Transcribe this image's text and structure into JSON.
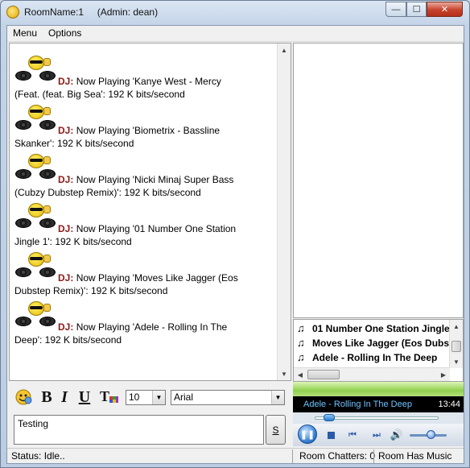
{
  "window": {
    "title": "RoomName:1     (Admin: dean)",
    "minimize_glyph": "—",
    "maximize_glyph": "☐",
    "close_glyph": "✕"
  },
  "menu": [
    "Menu",
    "Options"
  ],
  "chat": {
    "speaker": "DJ:",
    "messages": [
      {
        "line1": "Now Playing 'Kanye West - Mercy",
        "line2": "(Feat. (feat. Big Sea': 192 K bits/second"
      },
      {
        "line1": "Now Playing 'Biometrix - Bassline",
        "line2": "Skanker': 192 K bits/second"
      },
      {
        "line1": "Now Playing 'Nicki Minaj Super Bass",
        "line2": "(Cubzy Dubstep Remix)': 192 K bits/second"
      },
      {
        "line1": "Now Playing '01 Number One Station",
        "line2": "Jingle 1': 192 K bits/second"
      },
      {
        "line1": "Now Playing 'Moves Like Jagger (Eos",
        "line2": "Dubstep Remix)': 192 K bits/second"
      },
      {
        "line1": "Now Playing 'Adele - Rolling In The",
        "line2": "Deep': 192 K bits/second"
      }
    ]
  },
  "toolbar": {
    "bold": "B",
    "italic": "I",
    "underline": "U",
    "font_size": "10",
    "font_name": "Arial"
  },
  "input": {
    "value": "Testing",
    "send_label": "S"
  },
  "playlist": {
    "items": [
      "01 Number One Station Jingle",
      "Moves Like Jagger (Eos Dubst",
      "Adele - Rolling In The Deep"
    ]
  },
  "player": {
    "now_playing": "Adele - Rolling In The Deep",
    "time": "13:44",
    "seek_position": 0.08,
    "volume": 0.6
  },
  "status": {
    "state": "Status: Idle..",
    "chatters": "Room Chatters: 0",
    "music": "Room Has Music"
  },
  "colors": {
    "dj_label": "#8b1a1a",
    "now_playing_text": "#6cc2ff",
    "visualizer": "#8fd04f"
  }
}
